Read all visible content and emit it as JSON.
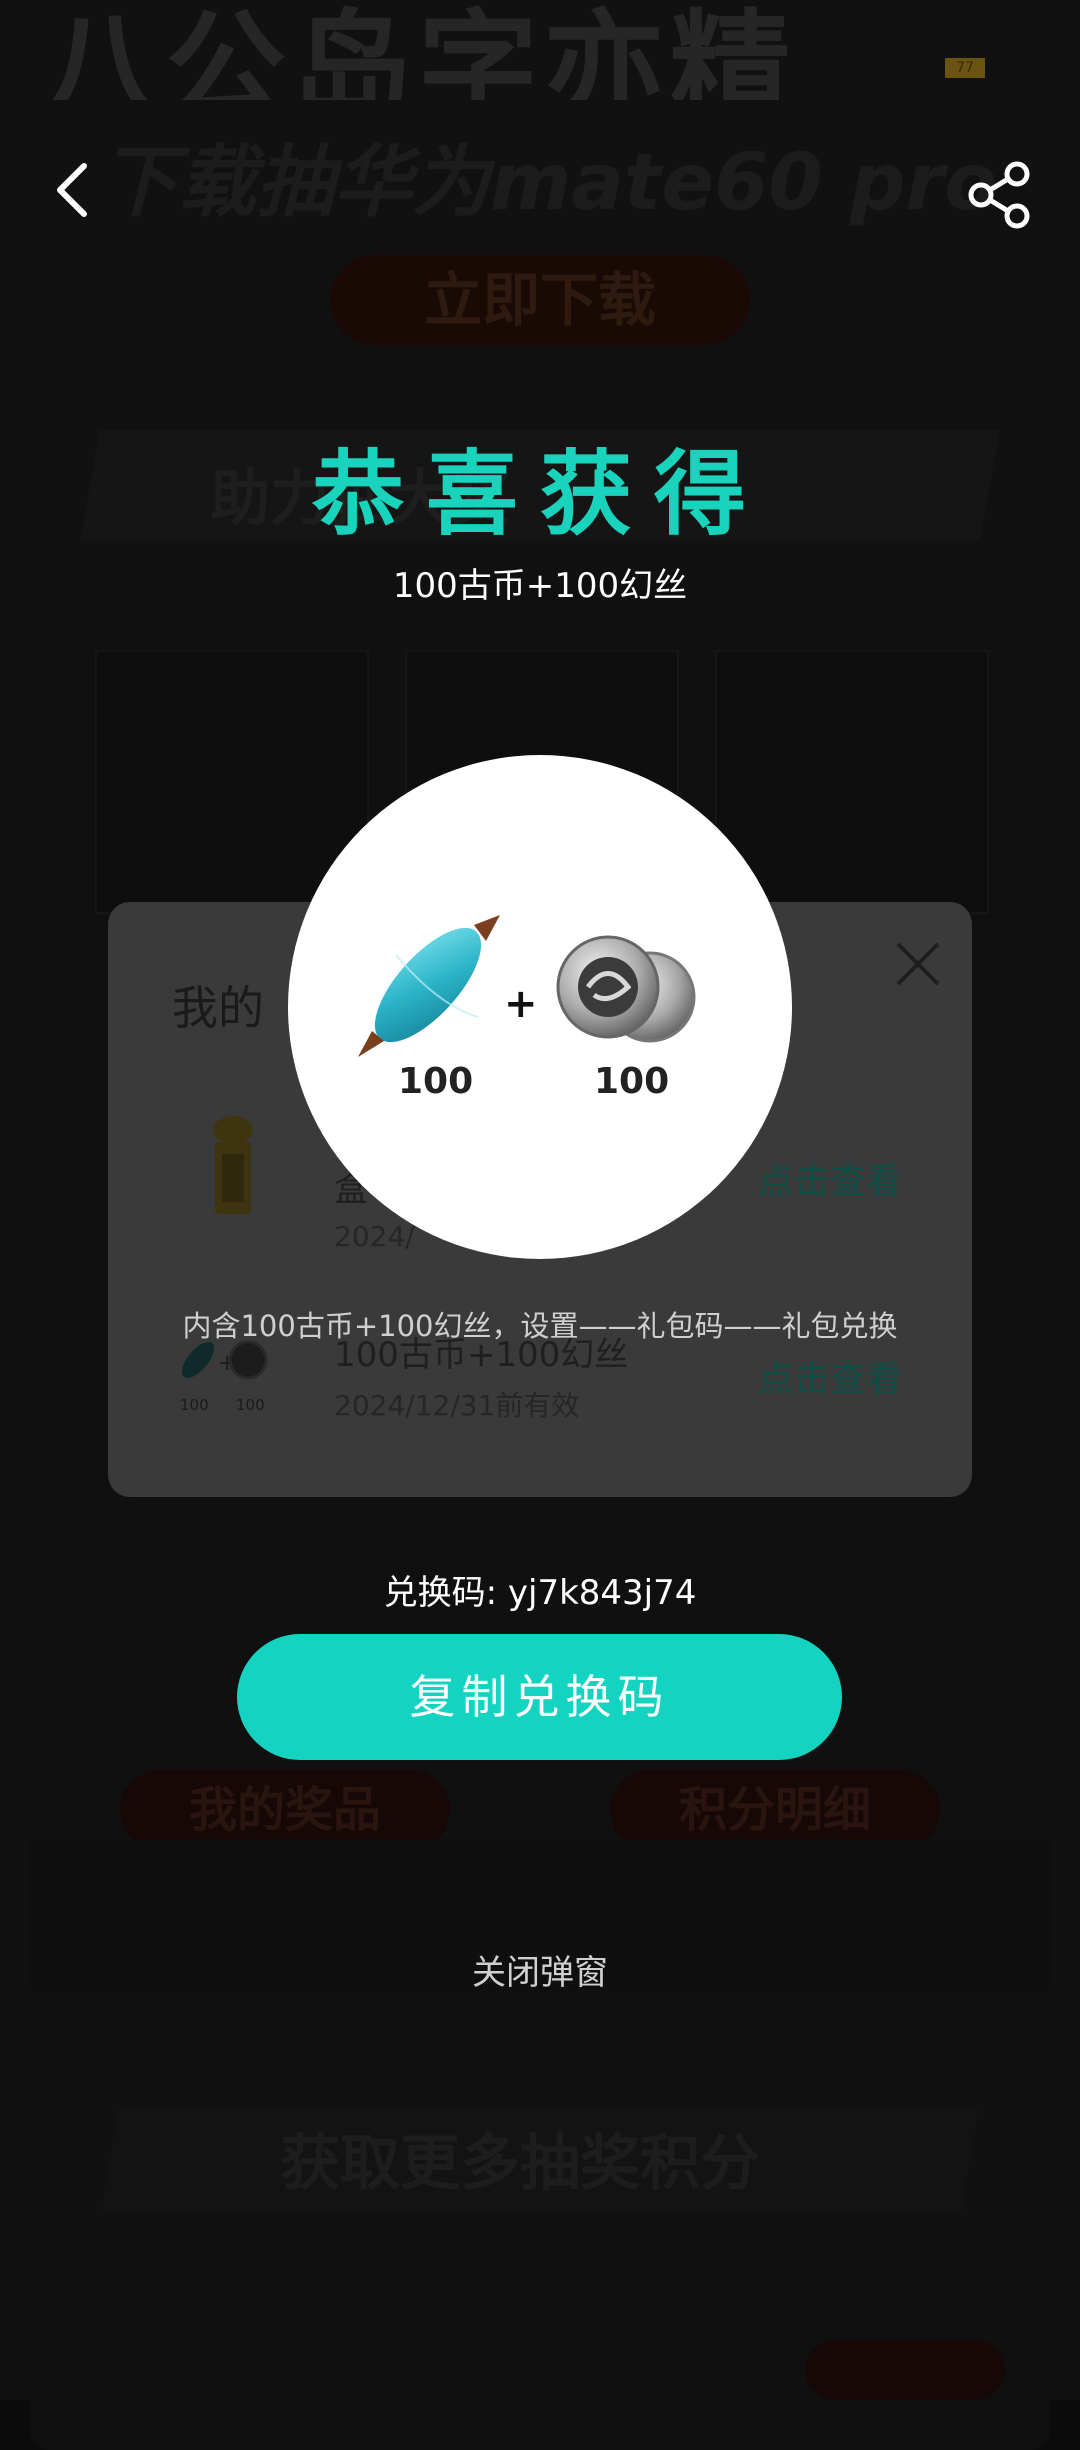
{
  "background": {
    "header_title": "八公岛字亦精",
    "badge": "77",
    "download_text": "下载抽华为mate60 pro",
    "download_button": "立即下载",
    "banner_text": "助力抽大奖",
    "more_banner": "获取更多抽奖积分",
    "pill_prizes": "我的奖品",
    "pill_points": "积分明细"
  },
  "nav": {
    "back_icon": "chevron-left-icon",
    "share_icon": "share-icon"
  },
  "popup": {
    "title": "恭喜获得",
    "subtitle": "100古币+100幻丝",
    "gift_counts": [
      "100",
      "100"
    ],
    "description": "内含100古币+100幻丝，设置——礼包码——礼包兑换",
    "code_line": "兑换码: yj7k843j74",
    "copy_button": "复制兑换码",
    "close_link": "关闭弹窗"
  },
  "my_dialog": {
    "title": "我的",
    "rows": [
      {
        "name": "盒",
        "date": "2024/",
        "link": "点击查看"
      },
      {
        "name": "100古币+100幻丝",
        "date": "2024/12/31前有效",
        "link": "点击查看"
      }
    ],
    "thumb_counts": [
      "100",
      "100"
    ]
  },
  "colors": {
    "accent": "#14d3c1",
    "overlay": "#0b0b0b",
    "dialog": "#3a3a3a"
  }
}
